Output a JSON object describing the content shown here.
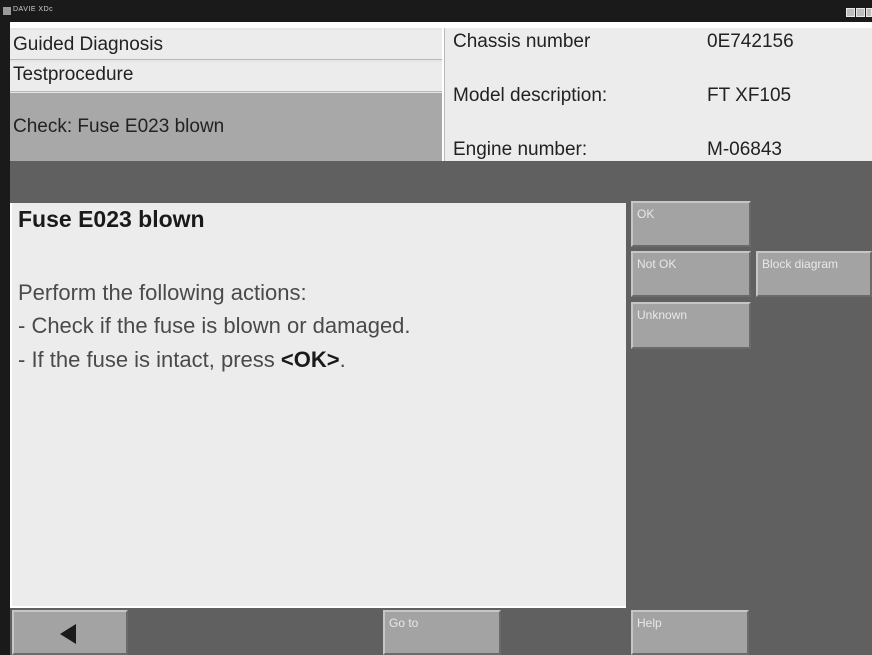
{
  "window": {
    "title": "DAVIE XDc"
  },
  "header": {
    "nav": {
      "guided_diagnosis": "Guided Diagnosis",
      "testprocedure": "Testprocedure",
      "current_check": "Check: Fuse E023 blown"
    },
    "vehicle": {
      "chassis_label": "Chassis number",
      "chassis_value": "0E742156",
      "model_label": "Model description:",
      "model_value": "FT XF105",
      "engine_label": "Engine number:",
      "engine_value": "M-06843"
    }
  },
  "content": {
    "title": "Fuse E023 blown",
    "instruction": "Perform the following actions:",
    "step1": "- Check if the fuse is blown or damaged.",
    "step2_prefix": "- If the fuse is intact, press ",
    "step2_key": "<OK>",
    "step2_suffix": "."
  },
  "actions": {
    "ok": "OK",
    "not_ok": "Not OK",
    "block_diagram": "Block diagram",
    "unknown": "Unknown"
  },
  "footer": {
    "back_icon": "back-arrow-icon",
    "goto": "Go to",
    "help": "Help"
  }
}
